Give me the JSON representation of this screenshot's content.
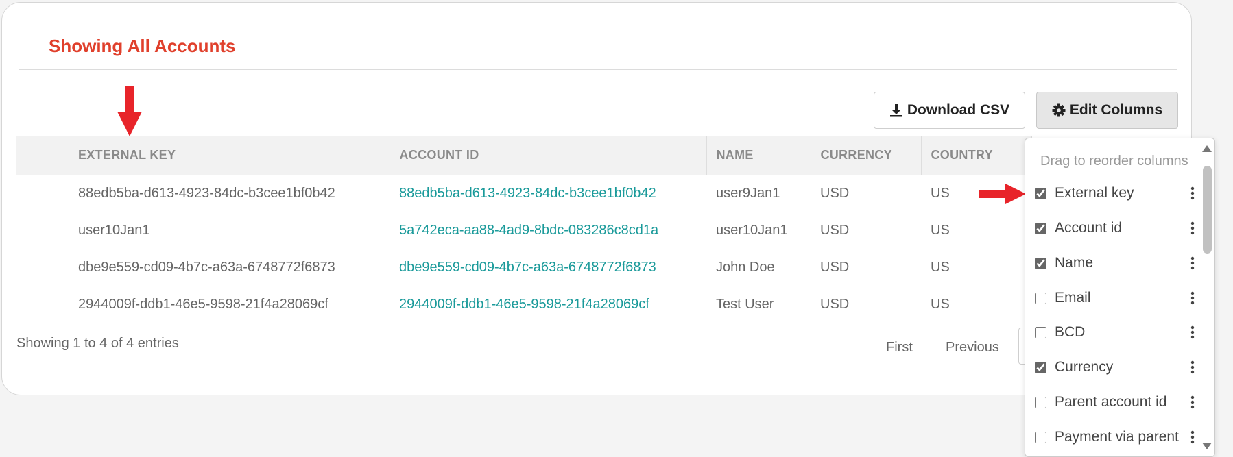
{
  "page": {
    "title": "Showing All Accounts"
  },
  "toolbar": {
    "download_label": "Download CSV",
    "edit_columns_label": "Edit Columns"
  },
  "table": {
    "headers": [
      "EXTERNAL KEY",
      "ACCOUNT ID",
      "NAME",
      "CURRENCY",
      "COUNTRY"
    ],
    "rows": [
      [
        "88edb5ba-d613-4923-84dc-b3cee1bf0b42",
        "88edb5ba-d613-4923-84dc-b3cee1bf0b42",
        "user9Jan1",
        "USD",
        "US"
      ],
      [
        "user10Jan1",
        "5a742eca-aa88-4ad9-8bdc-083286c8cd1a",
        "user10Jan1",
        "USD",
        "US"
      ],
      [
        "dbe9e559-cd09-4b7c-a63a-6748772f6873",
        "dbe9e559-cd09-4b7c-a63a-6748772f6873",
        "John Doe",
        "USD",
        "US"
      ],
      [
        "2944009f-ddb1-46e5-9598-21f4a28069cf",
        "2944009f-ddb1-46e5-9598-21f4a28069cf",
        "Test User",
        "USD",
        "US"
      ]
    ]
  },
  "footer": {
    "entries_info": "Showing 1 to 4 of 4 entries"
  },
  "pagination": {
    "first": "First",
    "previous": "Previous"
  },
  "column_editor": {
    "hint": "Drag to reorder columns",
    "items": [
      {
        "label": "External key",
        "checked": true
      },
      {
        "label": "Account id",
        "checked": true
      },
      {
        "label": "Name",
        "checked": true
      },
      {
        "label": "Email",
        "checked": false
      },
      {
        "label": "BCD",
        "checked": false
      },
      {
        "label": "Currency",
        "checked": true
      },
      {
        "label": "Parent account id",
        "checked": false
      },
      {
        "label": "Payment via parent",
        "checked": false
      }
    ]
  },
  "colors": {
    "title": "#e0402c",
    "link": "#1a9a9a",
    "annotation_arrow": "#e8242a"
  },
  "icons": {
    "download": "download-icon",
    "gear": "gear-icon",
    "kebab": "kebab-menu-icon"
  }
}
